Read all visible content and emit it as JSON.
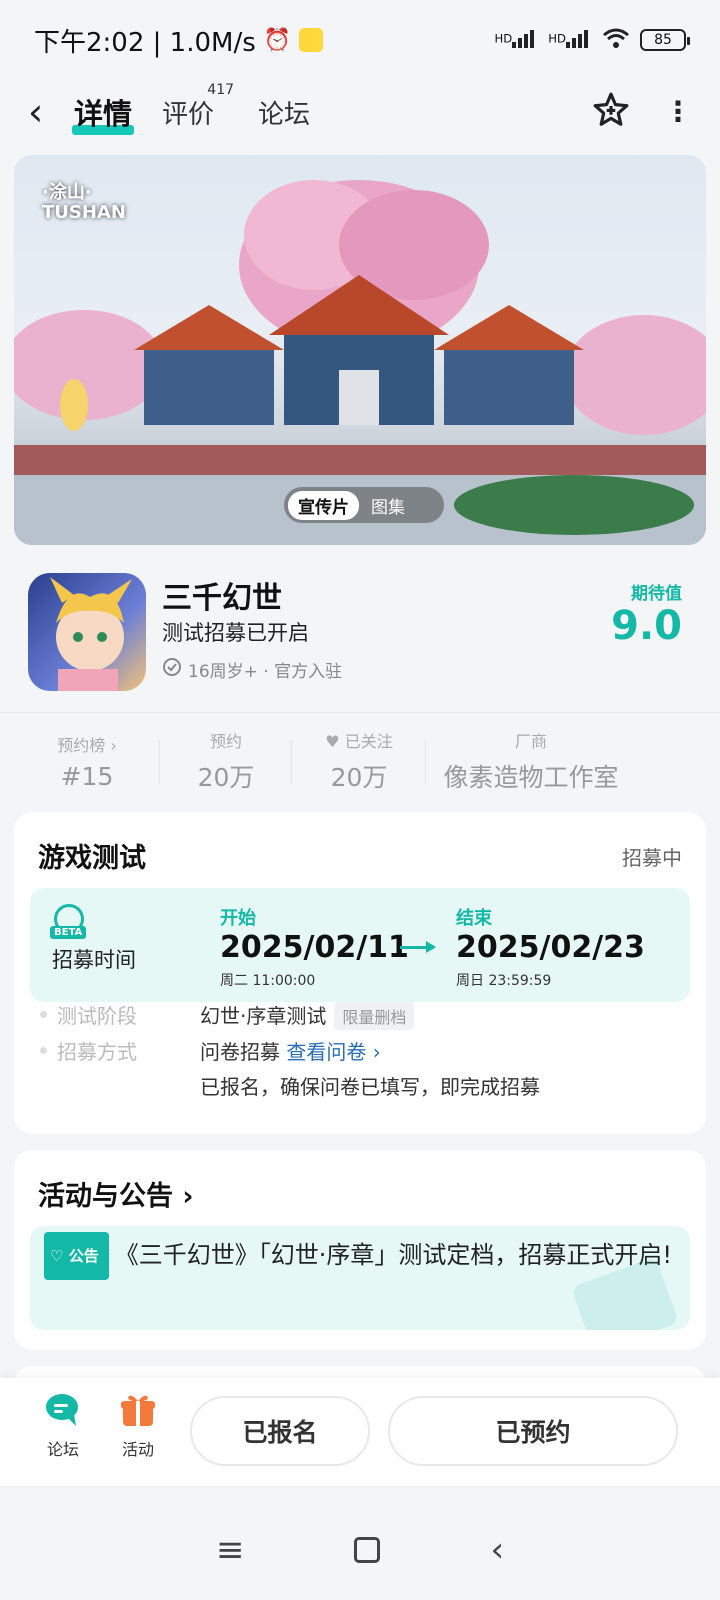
{
  "status_bar": {
    "time_speed": "下午2:02 | 1.0M/s",
    "signal1": "HD",
    "signal2": "HD",
    "battery": "85"
  },
  "nav": {
    "back_icon": "back-arrow-icon",
    "tabs": [
      {
        "label": "详情",
        "active": true
      },
      {
        "label": "评价",
        "count": "417"
      },
      {
        "label": "论坛"
      }
    ],
    "favorite_icon": "star-plus-icon",
    "more_icon": "more-icon"
  },
  "banner": {
    "logo_line1": "·涂山·",
    "logo_line2": "TUSHAN",
    "switch": {
      "active": "宣传片",
      "inactive": "图集"
    }
  },
  "game": {
    "name": "三千幻世",
    "slogan": "测试招募已开启",
    "tags": "16周岁+ · 官方入驻",
    "expect_label": "期待值",
    "expect_value": "9.0"
  },
  "stats": [
    {
      "label": "预约榜 ›",
      "value": "#15"
    },
    {
      "label": "预约",
      "value": "20万"
    },
    {
      "label": "已关注",
      "value": "20万"
    },
    {
      "label": "厂商",
      "value": "像素造物工作室"
    }
  ],
  "test_card": {
    "title": "游戏测试",
    "status": "招募中",
    "recruit_label": "招募时间",
    "beta_tag": "BETA",
    "start_label": "开始",
    "start_date": "2025/02/11",
    "start_time": "周二 11:00:00",
    "end_label": "结束",
    "end_date": "2025/02/23",
    "end_time": "周日 23:59:59",
    "stage_key": "测试阶段",
    "stage_val": "幻世·序章测试",
    "stage_tag": "限量删档",
    "method_key": "招募方式",
    "method_val": "问卷招募",
    "method_link": "查看问卷 ›",
    "method_note": "已报名，确保问卷已填写，即完成招募"
  },
  "news_card": {
    "title": "活动与公告 ›",
    "tag": "公告",
    "text": "《三千幻世》「幻世·序章」测试定档，招募正式开启!"
  },
  "bottom_bar": {
    "forum_label": "论坛",
    "activity_label": "活动",
    "signed_button": "已报名",
    "reserved_button": "已预约"
  },
  "colors": {
    "accent": "#14b8a6",
    "link": "#2a6db5"
  }
}
